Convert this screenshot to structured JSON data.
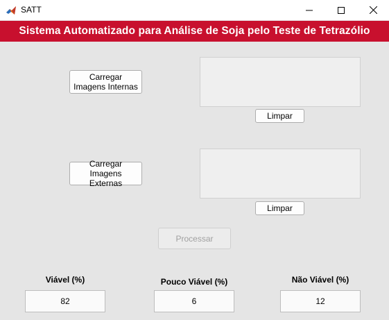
{
  "window": {
    "title": "SATT",
    "controls": [
      "minimize-icon",
      "maximize-icon",
      "close-icon"
    ]
  },
  "banner": {
    "title": "Sistema Automatizado para Análise de Soja pelo Teste de Tetrazólio",
    "color": "#c8102e"
  },
  "internal": {
    "load_label": "Carregar Imagens Internas",
    "clear_label": "Limpar"
  },
  "external": {
    "load_label": "Carregar Imagens Externas",
    "clear_label": "Limpar"
  },
  "process": {
    "label": "Processar",
    "enabled": false
  },
  "results": [
    {
      "label": "Viável (%)",
      "value": "82"
    },
    {
      "label": "Pouco Viável (%)",
      "value": "6"
    },
    {
      "label": "Não Viável (%)",
      "value": "12"
    }
  ]
}
